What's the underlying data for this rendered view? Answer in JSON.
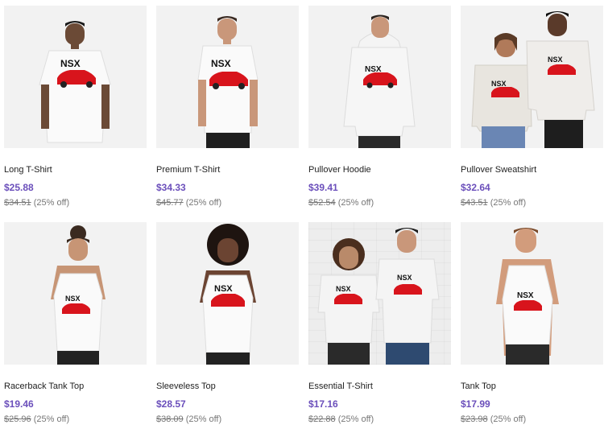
{
  "products": [
    {
      "title": "Long T-Shirt",
      "price": "$25.88",
      "original_price": "$34.51",
      "discount": "(25% off)"
    },
    {
      "title": "Premium T-Shirt",
      "price": "$34.33",
      "original_price": "$45.77",
      "discount": "(25% off)"
    },
    {
      "title": "Pullover Hoodie",
      "price": "$39.41",
      "original_price": "$52.54",
      "discount": "(25% off)"
    },
    {
      "title": "Pullover Sweatshirt",
      "price": "$32.64",
      "original_price": "$43.51",
      "discount": "(25% off)"
    },
    {
      "title": "Racerback Tank Top",
      "price": "$19.46",
      "original_price": "$25.96",
      "discount": "(25% off)"
    },
    {
      "title": "Sleeveless Top",
      "price": "$28.57",
      "original_price": "$38.09",
      "discount": "(25% off)"
    },
    {
      "title": "Essential T-Shirt",
      "price": "$17.16",
      "original_price": "$22.88",
      "discount": "(25% off)"
    },
    {
      "title": "Tank Top",
      "price": "$17.99",
      "original_price": "$23.98",
      "discount": "(25% off)"
    }
  ],
  "design_text": "NSX",
  "colors": {
    "price": "#6b4fbb",
    "car": "#d8141c",
    "thumb_bg": "#f2f2f2"
  }
}
